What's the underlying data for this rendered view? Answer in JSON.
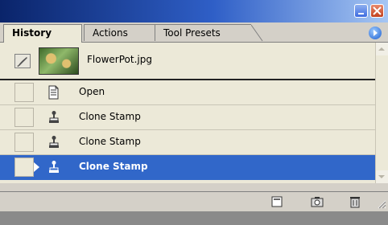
{
  "tabs": [
    {
      "label": "History"
    },
    {
      "label": "Actions"
    },
    {
      "label": "Tool Presets"
    }
  ],
  "snapshot": {
    "filename": "FlowerPot.jpg"
  },
  "history": [
    {
      "label": "Open",
      "icon": "open-document-icon"
    },
    {
      "label": "Clone Stamp",
      "icon": "clone-stamp-icon"
    },
    {
      "label": "Clone Stamp",
      "icon": "clone-stamp-icon"
    },
    {
      "label": "Clone Stamp",
      "icon": "clone-stamp-icon",
      "selected": true
    }
  ],
  "toolbar_icons": [
    "new-document-from-state-icon",
    "create-snapshot-icon",
    "delete-icon"
  ],
  "colors": {
    "title_bar": "#0a246a",
    "selection": "#3167c9",
    "panel_bg": "#ece9d8"
  }
}
